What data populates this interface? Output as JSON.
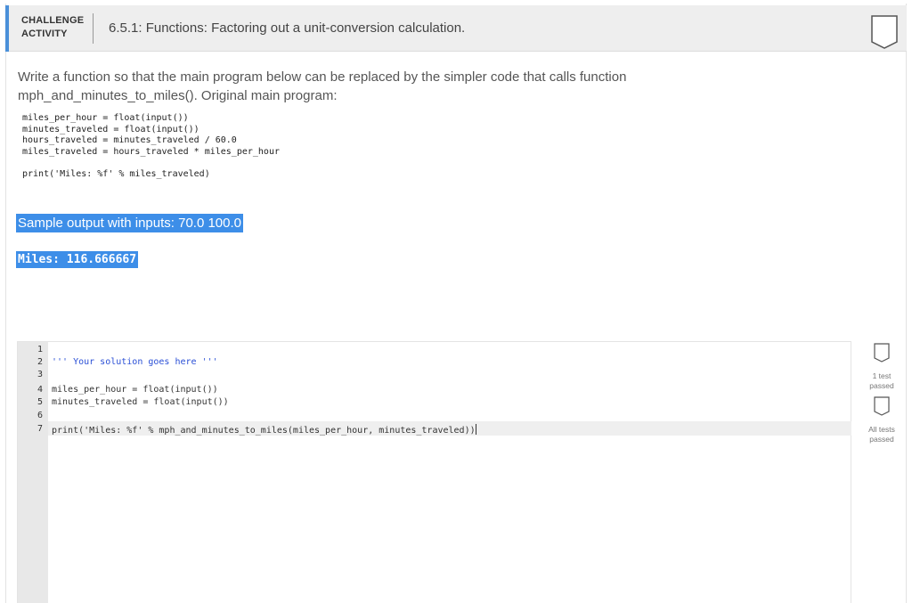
{
  "header": {
    "tag_line1": "CHALLENGE",
    "tag_line2": "ACTIVITY",
    "title": "6.5.1: Functions: Factoring out a unit-conversion calculation."
  },
  "instructions": "Write a function so that the main program below can be replaced by the simpler code that calls function mph_and_minutes_to_miles(). Original main program:",
  "original_code": [
    "miles_per_hour = float(input())",
    "minutes_traveled = float(input())",
    "hours_traveled = minutes_traveled / 60.0",
    "miles_traveled = hours_traveled * miles_per_hour",
    "",
    "print('Miles: %f' % miles_traveled)"
  ],
  "sample": {
    "label": "Sample output with inputs: 70.0 100.0",
    "output": "Miles: 116.666667"
  },
  "editor": {
    "line_numbers": [
      "1",
      "2",
      "3",
      "4",
      "5",
      "6",
      "7"
    ],
    "lines": [
      "",
      "''' Your solution goes here '''",
      "",
      "miles_per_hour = float(input())",
      "minutes_traveled = float(input())",
      "",
      "print('Miles: %f' % mph_and_minutes_to_miles(miles_per_hour, minutes_traveled))"
    ]
  },
  "status": {
    "one_test": "1 test passed",
    "all_tests": "All tests passed"
  },
  "colors": {
    "accent": "#4a90d9",
    "selection": "#3d8ee8",
    "string": "#2a4fd6"
  }
}
